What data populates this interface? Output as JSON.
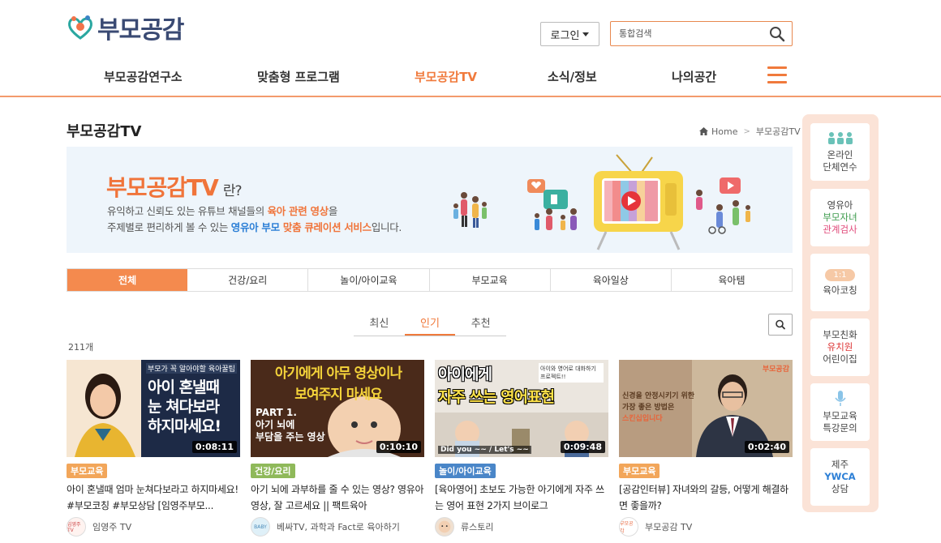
{
  "header": {
    "logo_text": "부모공감",
    "login_label": "로그인",
    "search_placeholder": "통합검색"
  },
  "nav": {
    "items": [
      {
        "label": "부모공감연구소"
      },
      {
        "label": "맞춤형 프로그램"
      },
      {
        "label": "부모공감TV",
        "active": true
      },
      {
        "label": "소식/정보"
      },
      {
        "label": "나의공간"
      }
    ]
  },
  "page": {
    "title": "부모공감TV",
    "breadcrumb": [
      "Home",
      "부모공감TV"
    ]
  },
  "banner": {
    "title": "부모공감TV",
    "title_suffix": "란?",
    "line1_pre": "유익하고 신뢰도 있는 유튜브 채널들의 ",
    "line1_bold": "육아 관련 영상",
    "line1_post": "을",
    "line2_pre": "주제별로 편리하게 볼 수 있는 ",
    "line2_bold_blue": "영유아 부모",
    "line2_bold": " 맞춤 큐레이션 서비스",
    "line2_post": "입니다."
  },
  "category_tabs": [
    "전체",
    "건강/요리",
    "놀이/아이교육",
    "부모교육",
    "육아일상",
    "육아템"
  ],
  "sort_tabs": [
    "최신",
    "인기",
    "추천"
  ],
  "count_label": "211개",
  "cards": [
    {
      "thumb_text": [
        "아이 혼낼때",
        "눈 쳐다보라",
        "하지마세요!"
      ],
      "thumb_top": "부모가 꼭 알아야할 육아꿀팁",
      "duration": "0:08:11",
      "tag": "부모교육",
      "title": "아이 혼낼때 엄마 눈쳐다보라고 하지마세요! #부모코칭 #부모상담 [임영주부모...",
      "channel": "임영주 TV",
      "avatar_text": "임영주TV"
    },
    {
      "thumb_text": [
        "아기에게 아무 영상이나",
        "보여주지 마세요"
      ],
      "thumb_sub": [
        "PART 1.",
        "아기 뇌에",
        "부담을 주는 영상"
      ],
      "duration": "0:10:10",
      "tag": "건강/요리",
      "title": "아기 뇌에 과부하를 줄 수 있는 영상? 영유아 영상, 잘 고르세요 || 팩트육아",
      "channel": "베싸TV, 과학과 Fact로 육아하기",
      "avatar_text": "BABY"
    },
    {
      "thumb_text": [
        "아이에게",
        "자주 쓰는 영어표현"
      ],
      "thumb_top": "아이와 영어로 대화하기 프로젝트!!",
      "thumb_bottom": "Did you ~~ / Let's ~~",
      "duration": "0:09:48",
      "tag": "놀이/아이교육",
      "title": "[육아영어] 초보도 가능한 아기에게 자주 쓰는 영어 표현 2가지 브이로그",
      "channel": "류스토리",
      "avatar_text": ""
    },
    {
      "thumb_text": [
        "신경을 안정시키기 위한",
        "가장 좋은 방법은",
        "스킨십입니다"
      ],
      "thumb_logo": "부모공감",
      "duration": "0:02:40",
      "tag": "부모교육",
      "title": "[공감인터뷰] 자녀와의 갈등, 어떻게 해결하면 좋을까?",
      "channel": "부모공감 TV",
      "avatar_text": "부모공감"
    }
  ],
  "quick_menu": [
    {
      "lines": [
        "온라인",
        "단체연수"
      ],
      "icon": "group-icon"
    },
    {
      "lines": [
        "영유아",
        "부모자녀",
        "관계검사"
      ]
    },
    {
      "pill": "1:1",
      "lines": [
        "육아코칭"
      ]
    },
    {
      "lines": [
        "부모친화",
        "유치원",
        "어린이집"
      ]
    },
    {
      "lines": [
        "부모교육",
        "특강문의"
      ],
      "icon": "microphone-icon"
    },
    {
      "lines": [
        "제주",
        "YWCA",
        "상담"
      ]
    }
  ],
  "colors": {
    "accent": "#f07a3c",
    "header_border": "#f39a6c",
    "banner_bg": "#eef5fb",
    "quick_bg": "#fbe3d7"
  }
}
